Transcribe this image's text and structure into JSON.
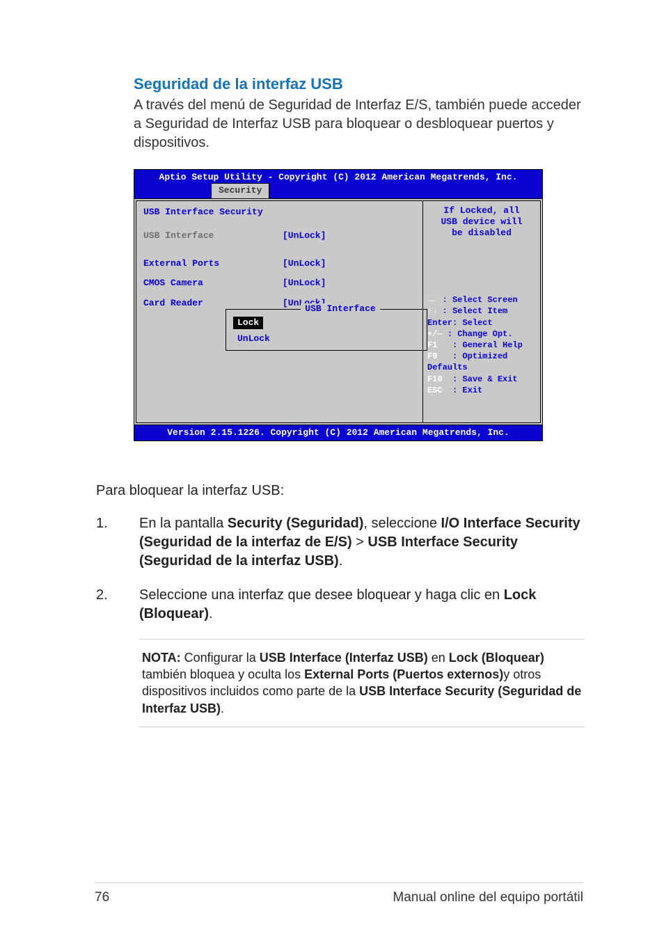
{
  "heading": "Seguridad de la interfaz USB",
  "intro": "A través del menú de Seguridad de Interfaz E/S, también puede acceder a Seguridad de Interfaz USB para bloquear o desbloquear puertos y dispositivos.",
  "bios": {
    "titlebar": "Aptio Setup Utility - Copyright (C) 2012 American Megatrends, Inc.",
    "tab": "Security",
    "section_title": "USB Interface Security",
    "rows": [
      {
        "label": "USB Interface",
        "value": "[UnLock]",
        "selected": true
      },
      {
        "label": "External Ports",
        "value": "[UnLock]",
        "selected": false
      },
      {
        "label": "CMOS Camera",
        "value": "[UnLock]",
        "selected": false
      },
      {
        "label": "Card Reader",
        "value": "[UnLock]",
        "selected": false
      }
    ],
    "popup": {
      "title": "USB Interface",
      "options": [
        "Lock",
        "UnLock"
      ],
      "selected": "Lock"
    },
    "help_top_line1": "If Locked, all",
    "help_top_line2": "USB device will",
    "help_top_line3": "be disabled",
    "keys": [
      {
        "k": "→←",
        "v": ": Select Screen"
      },
      {
        "k": "↑↓",
        "v": ": Select Item"
      },
      {
        "k": "Enter",
        "v": ": Select",
        "kcolor": "blue"
      },
      {
        "k": "+/—",
        "v": ": Change Opt."
      },
      {
        "k": "F1",
        "v": ": General Help"
      },
      {
        "k": "F9",
        "v": ": Optimized"
      },
      {
        "k": "",
        "v": "Defaults",
        "full": true
      },
      {
        "k": "F10",
        "v": ": Save & Exit"
      },
      {
        "k": "ESC",
        "v": ": Exit"
      }
    ],
    "footer": "Version 2.15.1226. Copyright (C) 2012 American Megatrends, Inc."
  },
  "lock_intro": "Para bloquear la interfaz USB:",
  "steps": {
    "s1_pre": "En la pantalla ",
    "s1_b1": "Security (Seguridad)",
    "s1_mid1": ", seleccione ",
    "s1_b2": "I/O Interface Security (Seguridad de la interfaz de E/S)",
    "s1_gt": " > ",
    "s1_b3": "USB Interface Security (Seguridad de la interfaz USB)",
    "s1_end": ".",
    "s2_pre": "Seleccione una interfaz que desee bloquear y haga clic en ",
    "s2_b1": "Lock (Bloquear)",
    "s2_end": "."
  },
  "note": {
    "label": "NOTA:",
    "t1": " Configurar la ",
    "b1": "USB Interface (Interfaz USB)",
    "t2": " en ",
    "b2": "Lock (Bloquear)",
    "t3": " también bloquea y oculta los ",
    "b3": "External Ports (Puertos externos)",
    "t4": "y otros dispositivos incluidos como parte de la ",
    "b4": "USB Interface Security (Seguridad de Interfaz USB)",
    "t5": "."
  },
  "footer": {
    "page": "76",
    "manual": "Manual online del equipo portátil"
  }
}
